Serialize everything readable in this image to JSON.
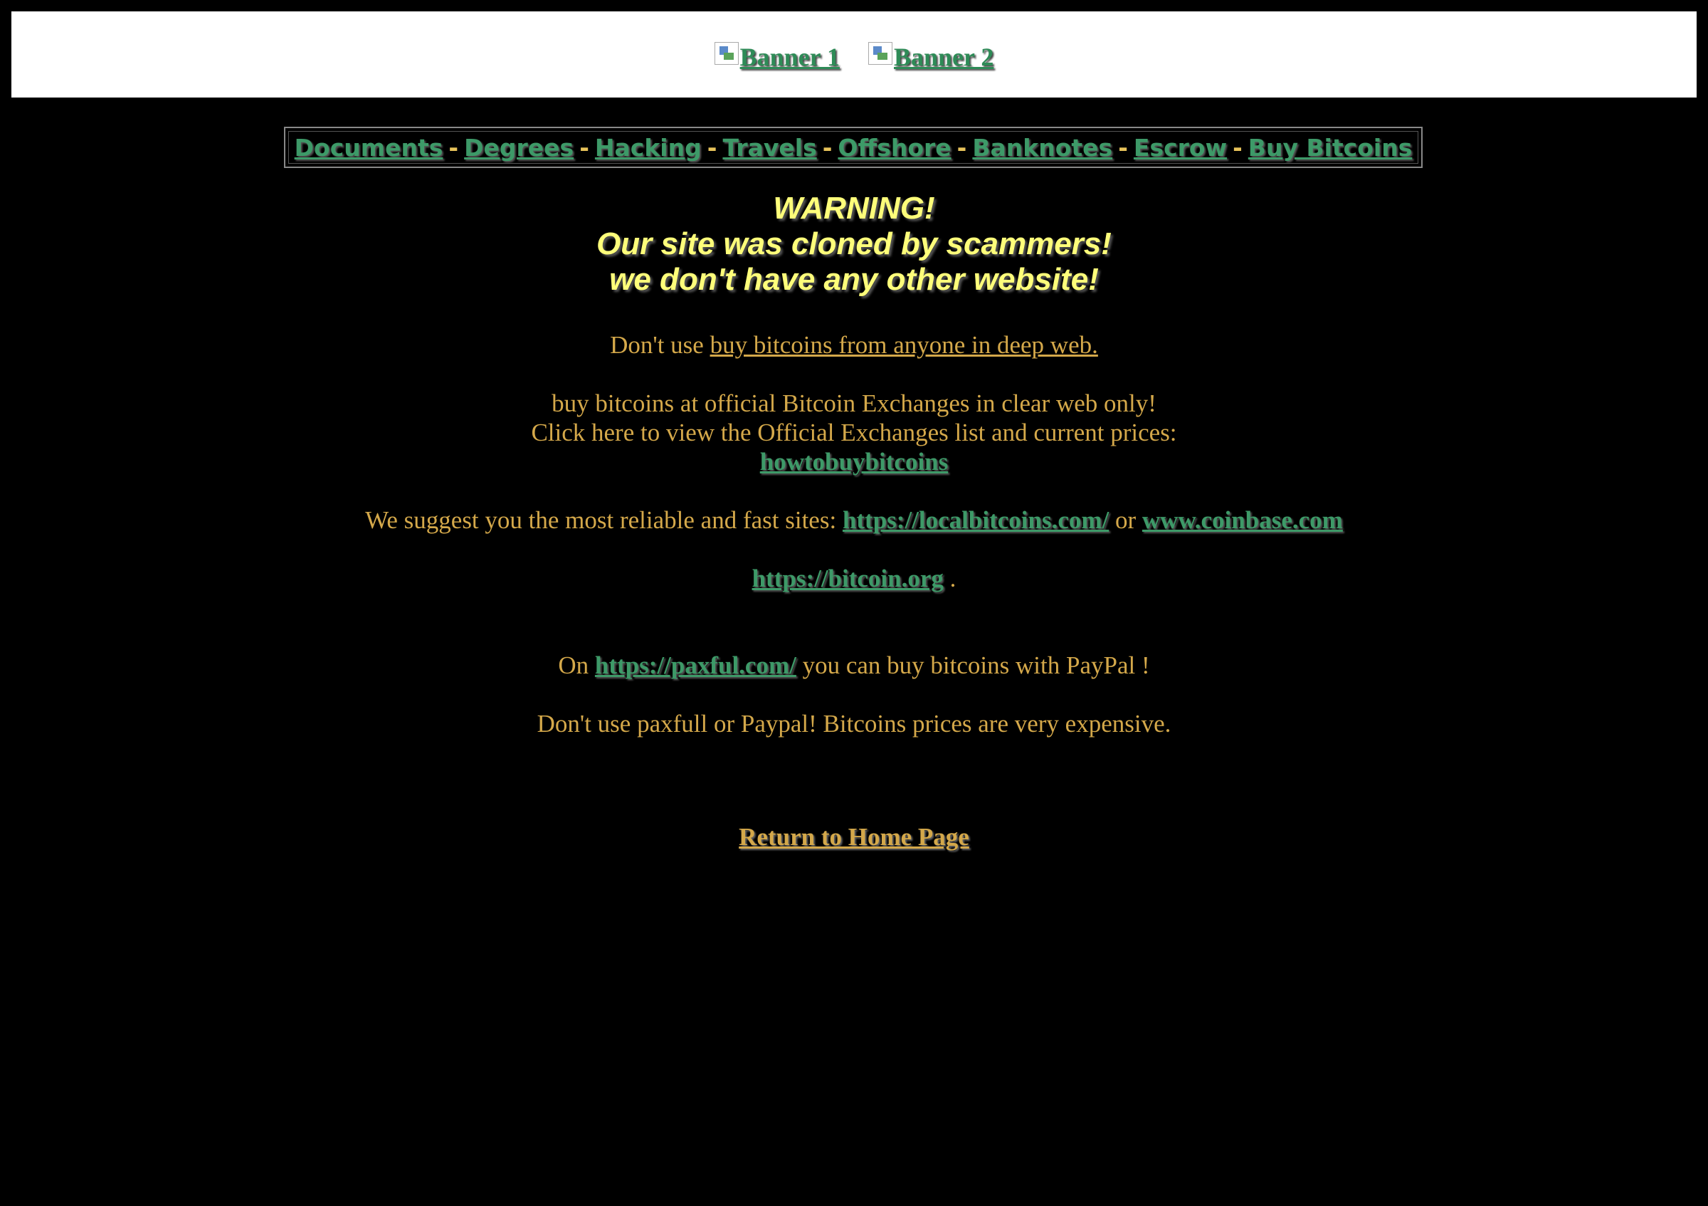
{
  "banners": [
    {
      "alt": "Banner 1"
    },
    {
      "alt": "Banner 2"
    }
  ],
  "nav": {
    "separator": "-",
    "items": [
      "Documents",
      "Degrees",
      "Hacking",
      "Travels",
      "Offshore",
      "Banknotes",
      "Escrow",
      "Buy Bitcoins"
    ]
  },
  "warning": {
    "line1": "WARNING!",
    "line2": "Our site was cloned by scammers!",
    "line3": "we don't have any other website!"
  },
  "dont_use": {
    "prefix": "Don't use ",
    "link": "buy bitcoins from anyone in deep web."
  },
  "official": {
    "line1": "buy bitcoins at official Bitcoin Exchanges in clear web only!",
    "line2": "Click here to view the Official Exchanges list and current prices:",
    "link": "howtobuybitcoins"
  },
  "suggest": {
    "prefix": "We suggest you the most reliable and fast sites: ",
    "link1": "https://localbitcoins.com/",
    "mid": " or ",
    "link2": "www.coinbase.com"
  },
  "bitcoin_org": {
    "link": "https://bitcoin.org",
    "suffix": " ."
  },
  "paxful": {
    "prefix": "On ",
    "link": "https://paxful.com/",
    "suffix": " you can buy bitcoins with PayPal !"
  },
  "dont_paypal": "Don't use paxfull or Paypal! Bitcoins prices are very expensive.",
  "home_link": "Return to Home Page",
  "colors": {
    "background": "#000000",
    "text": "#d4a84a",
    "link": "#3d9a68",
    "warning": "#ffff7a"
  }
}
